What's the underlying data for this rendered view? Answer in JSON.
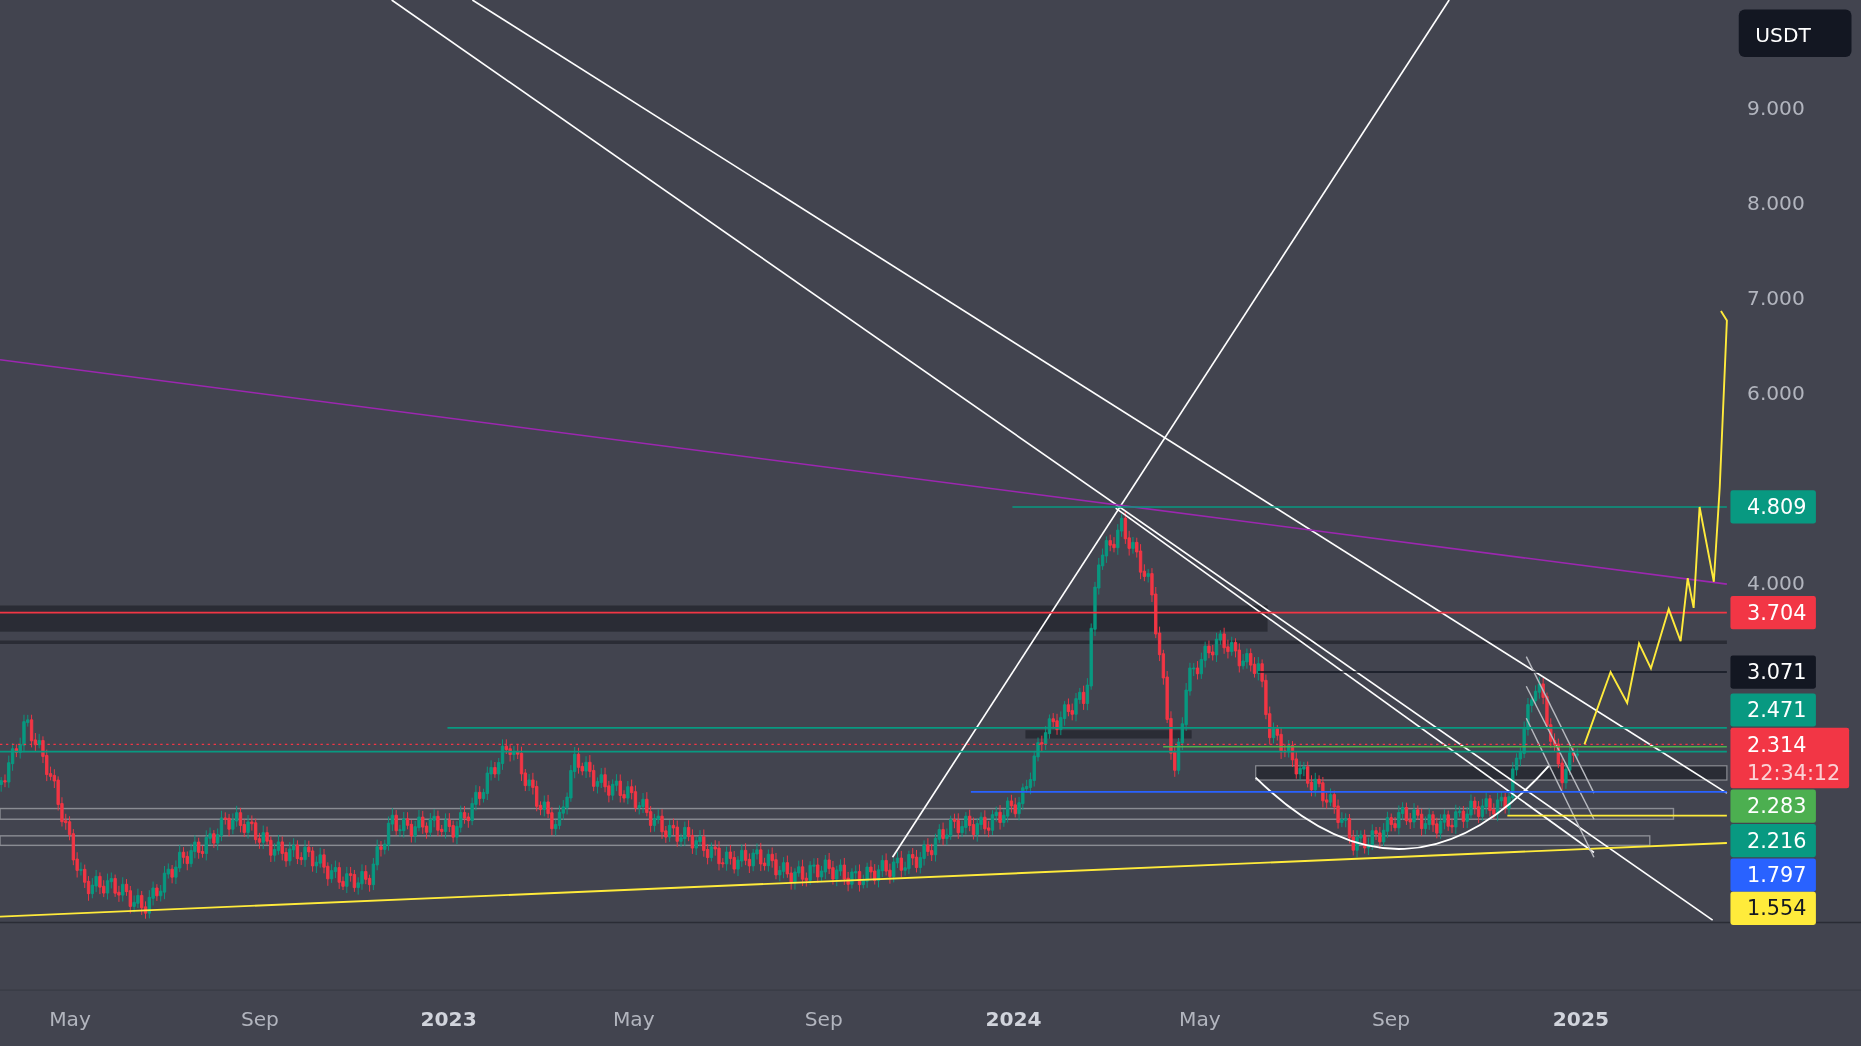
{
  "currency": "USDT",
  "price_ticks": [
    "9.000",
    "8.000",
    "7.000",
    "6.000",
    "4.000"
  ],
  "price_tags": [
    {
      "label": "4.809",
      "color": "#089981"
    },
    {
      "label": "3.704",
      "color": "#f23645"
    },
    {
      "label": "3.071",
      "color": "#131722"
    },
    {
      "label": "2.471",
      "color": "#089981"
    },
    {
      "label": "2.314",
      "countdown": "12:34:12",
      "color": "#f23645"
    },
    {
      "label": "2.283",
      "color": "#4caf50"
    },
    {
      "label": "2.216",
      "color": "#089981"
    },
    {
      "label": "1.797",
      "color": "#2962ff"
    },
    {
      "label": "1.554",
      "color": "#ffeb3b"
    }
  ],
  "time_labels": [
    {
      "label": "May",
      "kind": "month"
    },
    {
      "label": "Sep",
      "kind": "month"
    },
    {
      "label": "2023",
      "kind": "year"
    },
    {
      "label": "May",
      "kind": "month"
    },
    {
      "label": "Sep",
      "kind": "month"
    },
    {
      "label": "2024",
      "kind": "year"
    },
    {
      "label": "May",
      "kind": "month"
    },
    {
      "label": "Sep",
      "kind": "month"
    },
    {
      "label": "2025",
      "kind": "year"
    }
  ]
}
